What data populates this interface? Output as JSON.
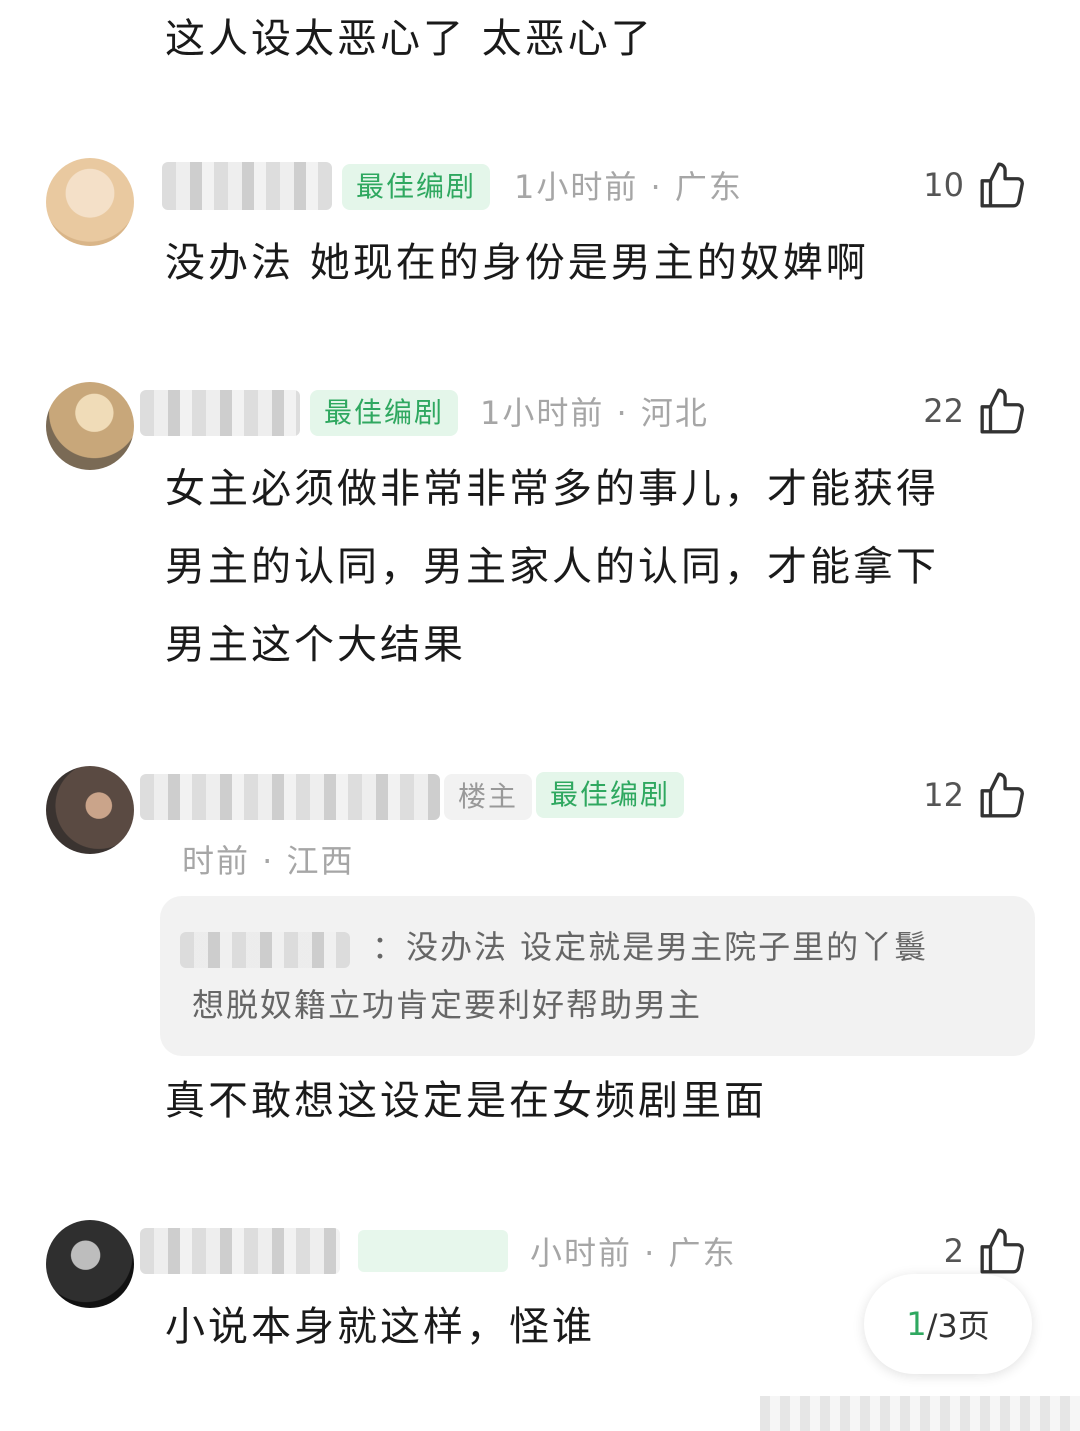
{
  "comments": [
    {
      "text": "这人设太恶心了 太恶心了"
    },
    {
      "badge": "最佳编剧",
      "meta": "1小时前 · 广东",
      "likes": "10",
      "text": "没办法 她现在的身份是男主的奴婢啊",
      "avatar_color": "#e9c9a0"
    },
    {
      "badge": "最佳编剧",
      "meta": "1小时前 · 河北",
      "likes": "22",
      "text_lines": [
        "女主必须做非常非常多的事儿，才能获得",
        "男主的认同，男主家人的认同，才能拿下",
        "男主这个大结果"
      ],
      "avatar_color": "#c8a77a"
    },
    {
      "tag": "楼主",
      "badge": "最佳编剧",
      "meta": "时前 · 江西",
      "likes": "12",
      "reply_lines": [
        "：没办法 设定就是男主院子里的丫鬟",
        "想脱奴籍立功肯定要利好帮助男主"
      ],
      "text": "真不敢想这设定是在女频剧里面",
      "avatar_color": "#5a4a42"
    },
    {
      "meta": "小时前 · 广东",
      "likes": "2",
      "text": "小说本身就这样，怪谁",
      "avatar_color": "#2f2f2f"
    }
  ],
  "pager": {
    "current": "1",
    "rest": "/3页"
  },
  "colors": {
    "accent": "#2fa860",
    "badge_bg": "#e4f6ea",
    "meta": "#a6a6a6"
  }
}
